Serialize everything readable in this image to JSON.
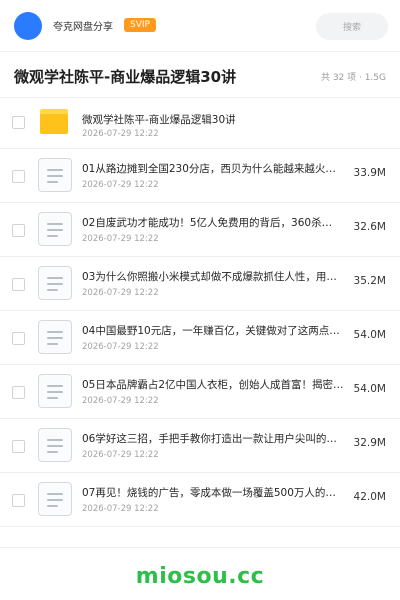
{
  "header": {
    "share_name": "夸克网盘分享",
    "badge": "SVIP",
    "search_placeholder": "搜索",
    "avatar_color": "#2b7bff",
    "badge_color": "#ff9a1f"
  },
  "title_bar": {
    "title": "微观学社陈平-商业爆品逻辑30讲",
    "meta": "共 32 项 · 1.5G"
  },
  "items": [
    {
      "name": "微观学社陈平-商业爆品逻辑30讲",
      "date": "2026-07-29 12:22",
      "size": "",
      "icon": "folder-icon"
    },
    {
      "name": "01从路边摊到全国230分店，西贝为什么能越来越火…",
      "date": "2026-07-29 12:22",
      "size": "33.9M",
      "icon": "document-icon"
    },
    {
      "name": "02自废武功才能成功！5亿人免费用的背后，360杀…",
      "date": "2026-07-29 12:22",
      "size": "32.6M",
      "icon": "document-icon"
    },
    {
      "name": "03为什么你照搬小米模式却做不成爆款抓住人性，用户…",
      "date": "2026-07-29 12:22",
      "size": "35.2M",
      "icon": "document-icon"
    },
    {
      "name": "04中国最野10元店，一年赚百亿，关键做对了这两点…",
      "date": "2026-07-29 12:22",
      "size": "54.0M",
      "icon": "document-icon"
    },
    {
      "name": "05日本品牌霸占2亿中国人衣柜，创始人成首富！揭密…",
      "date": "2026-07-29 12:22",
      "size": "54.0M",
      "icon": "document-icon"
    },
    {
      "name": "06学好这三招，手把手教你打造出一款让用户尖叫的爆…",
      "date": "2026-07-29 12:22",
      "size": "32.9M",
      "icon": "document-icon"
    },
    {
      "name": "07再见！烧钱的广告，零成本做一场覆盖500万人的…",
      "date": "2026-07-29 12:22",
      "size": "42.0M",
      "icon": "document-icon"
    }
  ],
  "watermark": "miosou.cc",
  "watermark_color": "#2fbe4a"
}
